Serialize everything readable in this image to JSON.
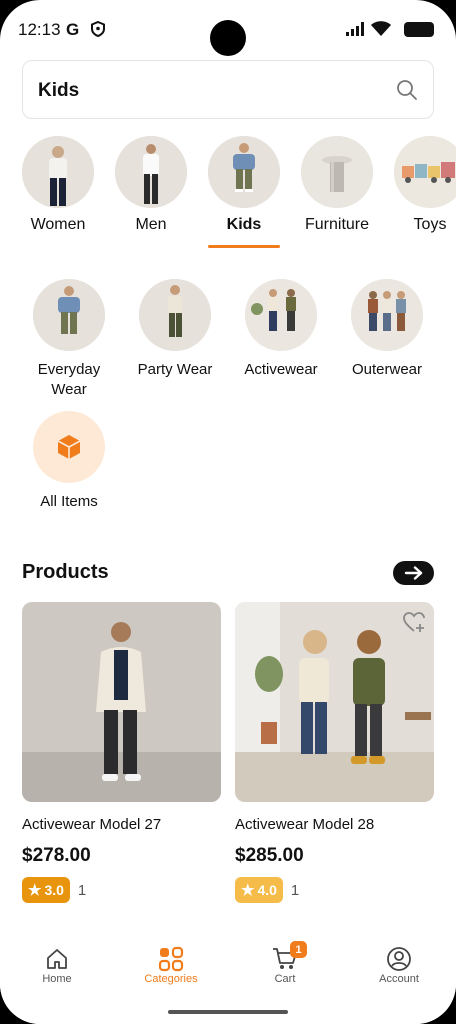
{
  "status": {
    "time": "12:13",
    "g_label": "G"
  },
  "search": {
    "query": "Kids"
  },
  "categories": [
    {
      "label": "Women",
      "active": false
    },
    {
      "label": "Men",
      "active": false
    },
    {
      "label": "Kids",
      "active": true
    },
    {
      "label": "Furniture",
      "active": false
    },
    {
      "label": "Toys",
      "active": false
    }
  ],
  "subcategories": [
    {
      "label": "Everyday Wear"
    },
    {
      "label": "Party Wear"
    },
    {
      "label": "Activewear"
    },
    {
      "label": "Outerwear"
    },
    {
      "label": "All Items"
    }
  ],
  "products_section": {
    "title": "Products"
  },
  "products": [
    {
      "name": "Activewear Model 27",
      "price": "$278.00",
      "rating": "3.0",
      "rating_count": "1",
      "badge_color": "#e8940c"
    },
    {
      "name": "Activewear Model 28",
      "price": "$285.00",
      "rating": "4.0",
      "rating_count": "1",
      "badge_color": "#f5bc4a"
    }
  ],
  "nav": {
    "items": [
      {
        "label": "Home",
        "icon": "home-icon"
      },
      {
        "label": "Categories",
        "icon": "categories-icon"
      },
      {
        "label": "Cart",
        "icon": "cart-icon"
      },
      {
        "label": "Account",
        "icon": "account-icon"
      }
    ],
    "cart_count": "1"
  },
  "colors": {
    "accent": "#f07c1c"
  }
}
